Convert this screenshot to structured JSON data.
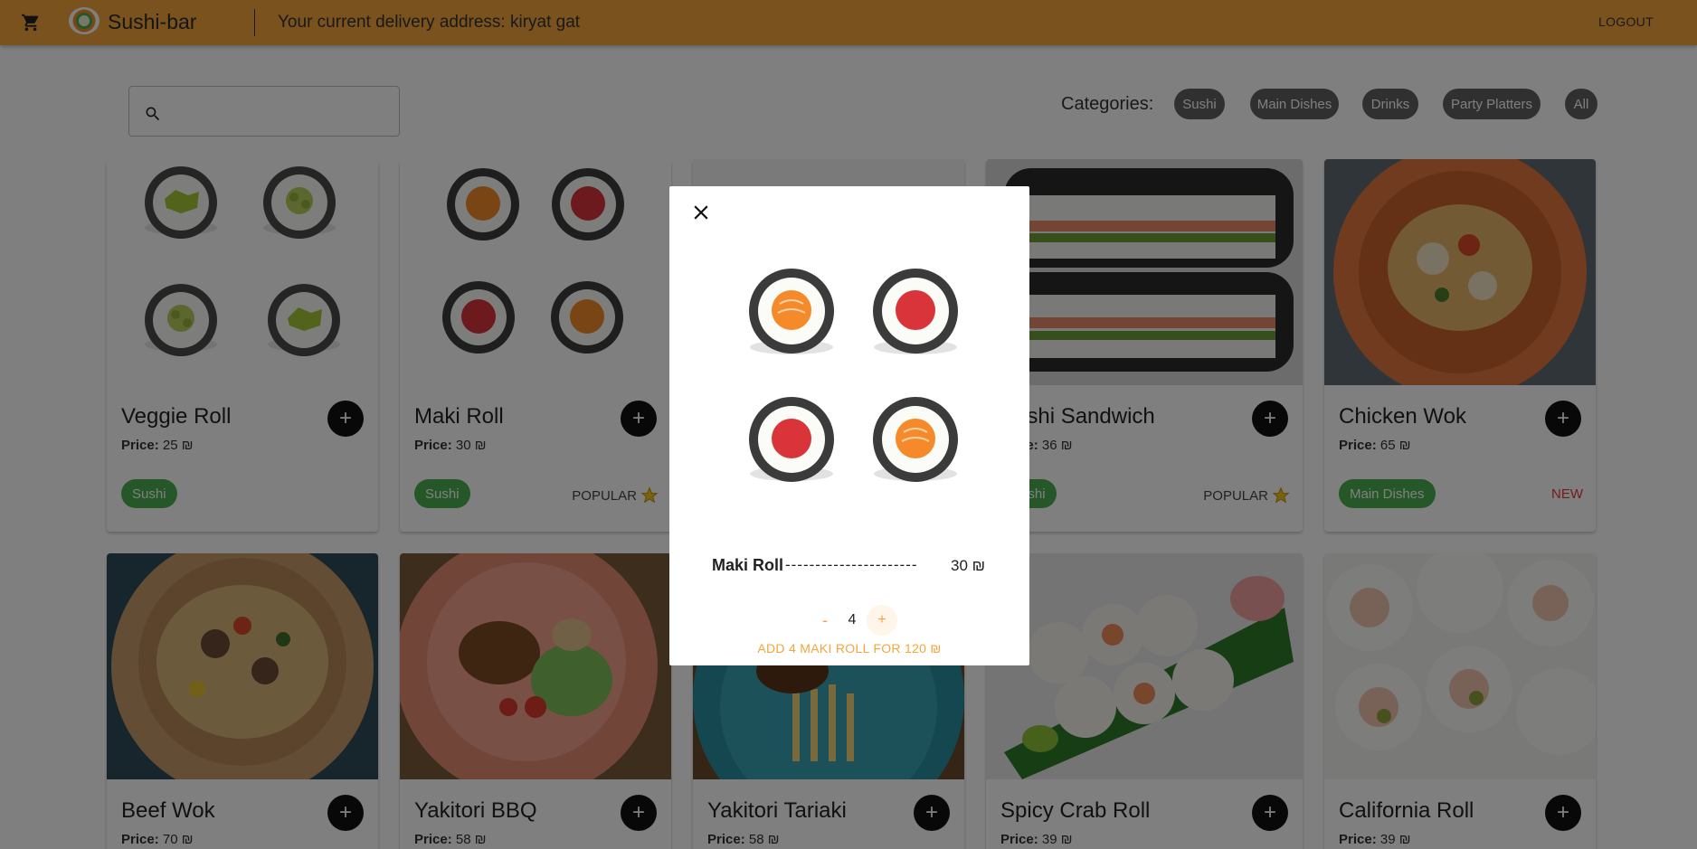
{
  "header": {
    "cart_icon": "cart-icon",
    "logo_icon": "sushi-logo",
    "title": "Sushi-bar",
    "address": "Your current delivery address: kiryat gat",
    "logout": "LOGOUT"
  },
  "search": {
    "placeholder": "",
    "icon": "search-icon"
  },
  "categories": {
    "label": "Categories:",
    "items": [
      "Sushi",
      "Main Dishes",
      "Drinks",
      "Party Platters",
      "All"
    ]
  },
  "price_label": "Price:",
  "currency": "₪",
  "products": [
    {
      "name": "Veggie Roll",
      "price": "25",
      "category": "Sushi",
      "flag": ""
    },
    {
      "name": "Maki Roll",
      "price": "30",
      "category": "Sushi",
      "flag": "POPULAR"
    },
    {
      "name": "Sushi Sandwich",
      "price": "36",
      "category": "Sushi",
      "flag": "POPULAR"
    },
    {
      "name": "Chicken Wok",
      "price": "65",
      "category": "Main Dishes",
      "flag": "NEW"
    },
    {
      "name": "Beef Wok",
      "price": "70"
    },
    {
      "name": "Yakitori BBQ",
      "price": "58"
    },
    {
      "name": "Yakitori Tariaki",
      "price": "58"
    },
    {
      "name": "Spicy Crab Roll",
      "price": "39"
    },
    {
      "name": "California Roll",
      "price": "39"
    }
  ],
  "modal": {
    "item_name": "Maki Roll",
    "dashes": "----------------------",
    "price": "30 ₪",
    "quantity": "4",
    "minus": "-",
    "plus": "+",
    "add_button": "ADD 4 MAKI ROLL FOR 120 ₪",
    "close_icon": "close-icon"
  },
  "colors": {
    "header": "#f5a53c",
    "accent": "#f5a53c",
    "category_tag": "#4caf50",
    "chip": "#616161",
    "new_flag": "#e53935"
  }
}
